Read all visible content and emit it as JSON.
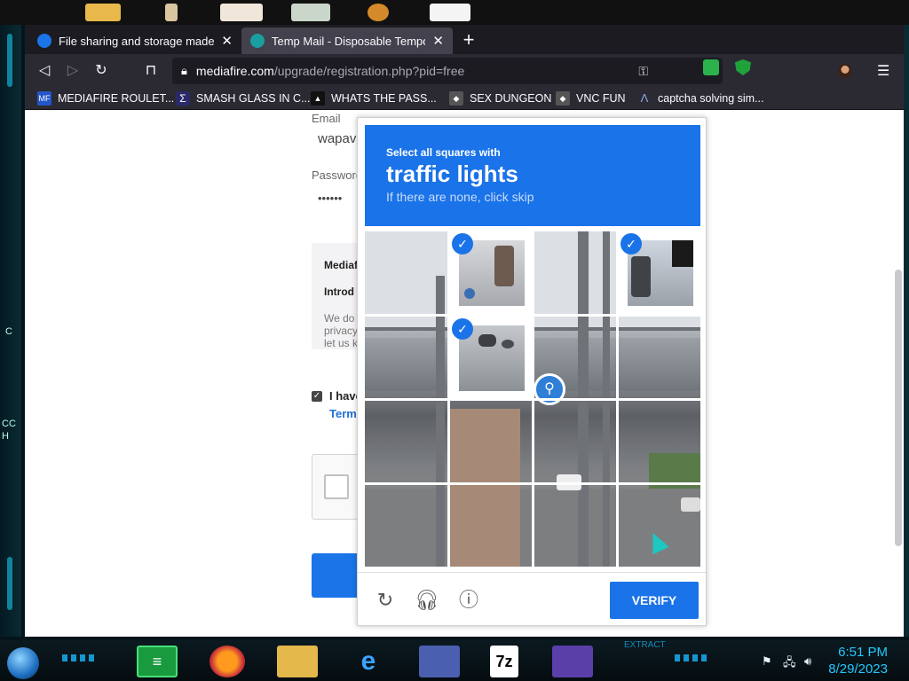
{
  "tabs": [
    {
      "title": "File sharing and storage made simple",
      "active": false
    },
    {
      "title": "Temp Mail - Disposable Temporary Email",
      "active": true
    }
  ],
  "url": {
    "domain": "mediafire.com",
    "path": "/upgrade/registration.php?pid=free"
  },
  "bookmarks": [
    {
      "label": "MEDIAFIRE ROULET...",
      "icon_text": "MF"
    },
    {
      "label": "SMASH GLASS IN C...",
      "icon_text": "Σ"
    },
    {
      "label": "WHATS THE PASS...",
      "icon_text": "▲"
    },
    {
      "label": "SEX DUNGEON",
      "icon_text": "◆"
    },
    {
      "label": "VNC FUN",
      "icon_text": "◆"
    },
    {
      "label": "captcha solving sim...",
      "icon_text": "Λ"
    }
  ],
  "form": {
    "email_label": "Email",
    "email_value": "wapav",
    "password_label": "Password",
    "password_value": "••••••",
    "terms_title": "Mediaf",
    "terms_intro": "Introd",
    "terms_line1": "We do",
    "terms_line2": "privacy",
    "terms_line3": "let us k",
    "agree_text": "I have",
    "terms_link": "Term"
  },
  "captcha": {
    "line1": "Select all squares with",
    "line2": "traffic lights",
    "line3": "If there are none, click skip",
    "verify_label": "VERIFY",
    "selected_tiles": [
      2,
      4,
      6
    ],
    "check_glyph": "✓"
  },
  "desktop": {
    "left_text_1": "C",
    "left_text_2": "CC",
    "left_text_3": "H"
  },
  "taskbar": {
    "extract_text": "EXTRACT",
    "time": "6:51 PM",
    "date": "8/29/2023",
    "sevenzip_label": "7z"
  },
  "colors": {
    "accent": "#1a73e8",
    "clock": "#22c9ff"
  }
}
